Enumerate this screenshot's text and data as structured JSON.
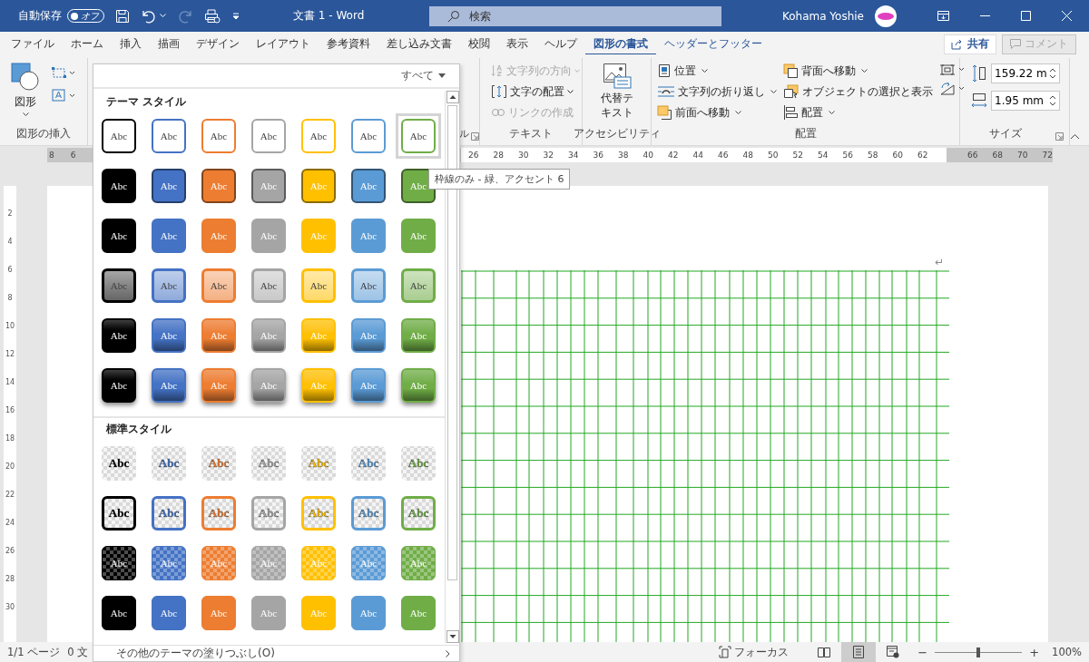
{
  "title_bar": {
    "autosave_label": "自動保存",
    "autosave_toggle": {
      "label": "オフ",
      "on": false
    },
    "title": "文書 1 - Word",
    "search": {
      "placeholder": "検索"
    },
    "user_name": "Kohama Yoshie"
  },
  "ribbon_tabs": [
    {
      "label": "ファイル",
      "selected": false,
      "kind": "normal"
    },
    {
      "label": "ホーム",
      "selected": false,
      "kind": "normal"
    },
    {
      "label": "挿入",
      "selected": false,
      "kind": "normal"
    },
    {
      "label": "描画",
      "selected": false,
      "kind": "normal"
    },
    {
      "label": "デザイン",
      "selected": false,
      "kind": "normal"
    },
    {
      "label": "レイアウト",
      "selected": false,
      "kind": "normal"
    },
    {
      "label": "参考資料",
      "selected": false,
      "kind": "normal"
    },
    {
      "label": "差し込み文書",
      "selected": false,
      "kind": "normal"
    },
    {
      "label": "校閲",
      "selected": false,
      "kind": "normal"
    },
    {
      "label": "表示",
      "selected": false,
      "kind": "normal"
    },
    {
      "label": "ヘルプ",
      "selected": false,
      "kind": "normal"
    },
    {
      "label": "図形の書式",
      "selected": true,
      "kind": "normal"
    },
    {
      "label": "ヘッダーとフッター",
      "selected": false,
      "kind": "contextual"
    }
  ],
  "share_button": "共有",
  "comment_button": {
    "label": "コメント",
    "disabled": true
  },
  "ribbon": {
    "insert_shapes": {
      "shapes_button": "図形",
      "label": "図形の挿入"
    },
    "wordart": {
      "label": "ル"
    },
    "text_group": {
      "label": "テキスト",
      "buttons": [
        {
          "label": "文字列の方向",
          "disabled": true,
          "dropdown": true
        },
        {
          "label": "文字の配置",
          "disabled": false,
          "dropdown": true
        },
        {
          "label": "リンクの作成",
          "disabled": true,
          "dropdown": false
        }
      ]
    },
    "accessibility": {
      "label": "アクセシビリティ",
      "alt_text_button": "代替テキスト"
    },
    "arrange": {
      "label": "配置",
      "column_1": [
        {
          "label": "位置",
          "dropdown": true
        },
        {
          "label": "文字列の折り返し",
          "dropdown": true
        },
        {
          "label": "前面へ移動",
          "dropdown": true
        }
      ],
      "column_2": [
        {
          "label": "背面へ移動",
          "dropdown": true
        },
        {
          "label": "オブジェクトの選択と表示",
          "dropdown": false
        },
        {
          "label": "配置",
          "dropdown": true
        }
      ]
    },
    "size": {
      "label": "サイズ",
      "height": "159.22 m",
      "width": "1.95 mm"
    }
  },
  "ruler": {
    "left_numbers": [
      "8",
      "6"
    ],
    "numbers": [
      "26",
      "28",
      "30",
      "32",
      "34",
      "36",
      "38",
      "40",
      "42",
      "44",
      "46",
      "48",
      "50",
      "52",
      "54",
      "56",
      "58",
      "60",
      "62"
    ],
    "right_numbers": [
      "66",
      "68",
      "70",
      "72"
    ]
  },
  "vertical_ruler": [
    "2",
    "4",
    "6",
    "8",
    "10",
    "12",
    "14",
    "16",
    "18",
    "20",
    "22",
    "24",
    "26",
    "28",
    "30"
  ],
  "document": {
    "paragraph_mark": "↵"
  },
  "gallery": {
    "filter": "すべて",
    "theme_heading": "テーマ スタイル",
    "theme_styles": [
      {
        "kind": "outline",
        "swatches": [
          {
            "label": "Abc",
            "color": "#000000",
            "selected": false
          },
          {
            "label": "Abc",
            "color": "#4472c4",
            "selected": false
          },
          {
            "label": "Abc",
            "color": "#ed7d31",
            "selected": false
          },
          {
            "label": "Abc",
            "color": "#a5a5a5",
            "selected": false
          },
          {
            "label": "Abc",
            "color": "#ffc000",
            "selected": false
          },
          {
            "label": "Abc",
            "color": "#5b9bd5",
            "selected": false
          },
          {
            "label": "Abc",
            "color": "#70ad47",
            "selected": true
          }
        ]
      },
      {
        "kind": "fill_outline",
        "swatches": [
          {
            "label": "Abc",
            "color": "#000000",
            "selected": false
          },
          {
            "label": "Abc",
            "color": "#4472c4",
            "selected": false
          },
          {
            "label": "Abc",
            "color": "#ed7d31",
            "selected": false
          },
          {
            "label": "Abc",
            "color": "#a5a5a5",
            "selected": false
          },
          {
            "label": "Abc",
            "color": "#ffc000",
            "selected": false
          },
          {
            "label": "Abc",
            "color": "#5b9bd5",
            "selected": false
          },
          {
            "label": "Abc",
            "color": "#70ad47",
            "selected": false
          }
        ]
      },
      {
        "kind": "fill",
        "swatches": [
          {
            "label": "Abc",
            "color": "#000000",
            "selected": false
          },
          {
            "label": "Abc",
            "color": "#4472c4",
            "selected": false
          },
          {
            "label": "Abc",
            "color": "#ed7d31",
            "selected": false
          },
          {
            "label": "Abc",
            "color": "#a5a5a5",
            "selected": false
          },
          {
            "label": "Abc",
            "color": "#ffc000",
            "selected": false
          },
          {
            "label": "Abc",
            "color": "#5b9bd5",
            "selected": false
          },
          {
            "label": "Abc",
            "color": "#70ad47",
            "selected": false
          }
        ]
      },
      {
        "kind": "light",
        "swatches": [
          {
            "label": "Abc",
            "color": "#000000",
            "selected": false
          },
          {
            "label": "Abc",
            "color": "#4472c4",
            "selected": false
          },
          {
            "label": "Abc",
            "color": "#ed7d31",
            "selected": false
          },
          {
            "label": "Abc",
            "color": "#a5a5a5",
            "selected": false
          },
          {
            "label": "Abc",
            "color": "#ffc000",
            "selected": false
          },
          {
            "label": "Abc",
            "color": "#5b9bd5",
            "selected": false
          },
          {
            "label": "Abc",
            "color": "#70ad47",
            "selected": false
          }
        ]
      },
      {
        "kind": "gradient",
        "swatches": [
          {
            "label": "Abc",
            "color": "#000000",
            "selected": false
          },
          {
            "label": "Abc",
            "color": "#4472c4",
            "selected": false
          },
          {
            "label": "Abc",
            "color": "#ed7d31",
            "selected": false
          },
          {
            "label": "Abc",
            "color": "#a5a5a5",
            "selected": false
          },
          {
            "label": "Abc",
            "color": "#ffc000",
            "selected": false
          },
          {
            "label": "Abc",
            "color": "#5b9bd5",
            "selected": false
          },
          {
            "label": "Abc",
            "color": "#70ad47",
            "selected": false
          }
        ]
      },
      {
        "kind": "shadow",
        "swatches": [
          {
            "label": "Abc",
            "color": "#000000",
            "selected": false
          },
          {
            "label": "Abc",
            "color": "#4472c4",
            "selected": false
          },
          {
            "label": "Abc",
            "color": "#ed7d31",
            "selected": false
          },
          {
            "label": "Abc",
            "color": "#a5a5a5",
            "selected": false
          },
          {
            "label": "Abc",
            "color": "#ffc000",
            "selected": false
          },
          {
            "label": "Abc",
            "color": "#5b9bd5",
            "selected": false
          },
          {
            "label": "Abc",
            "color": "#70ad47",
            "selected": false
          }
        ]
      }
    ],
    "standard_heading": "標準スタイル",
    "standard_styles": [
      {
        "kind": "checker",
        "swatches": [
          {
            "label": "Abc",
            "color": "#000000",
            "selected": false
          },
          {
            "label": "Abc",
            "color": "#4472c4",
            "selected": false
          },
          {
            "label": "Abc",
            "color": "#ed7d31",
            "selected": false
          },
          {
            "label": "Abc",
            "color": "#a5a5a5",
            "selected": false
          },
          {
            "label": "Abc",
            "color": "#ffc000",
            "selected": false
          },
          {
            "label": "Abc",
            "color": "#5b9bd5",
            "selected": false
          },
          {
            "label": "Abc",
            "color": "#70ad47",
            "selected": false
          }
        ]
      },
      {
        "kind": "checker_outline",
        "swatches": [
          {
            "label": "Abc",
            "color": "#000000",
            "selected": false
          },
          {
            "label": "Abc",
            "color": "#4472c4",
            "selected": false
          },
          {
            "label": "Abc",
            "color": "#ed7d31",
            "selected": false
          },
          {
            "label": "Abc",
            "color": "#a5a5a5",
            "selected": false
          },
          {
            "label": "Abc",
            "color": "#ffc000",
            "selected": false
          },
          {
            "label": "Abc",
            "color": "#5b9bd5",
            "selected": false
          },
          {
            "label": "Abc",
            "color": "#70ad47",
            "selected": false
          }
        ]
      },
      {
        "kind": "checker_fill",
        "swatches": [
          {
            "label": "Abc",
            "color": "#000000",
            "selected": false
          },
          {
            "label": "Abc",
            "color": "#4472c4",
            "selected": false
          },
          {
            "label": "Abc",
            "color": "#ed7d31",
            "selected": false
          },
          {
            "label": "Abc",
            "color": "#a5a5a5",
            "selected": false
          },
          {
            "label": "Abc",
            "color": "#ffc000",
            "selected": false
          },
          {
            "label": "Abc",
            "color": "#5b9bd5",
            "selected": false
          },
          {
            "label": "Abc",
            "color": "#70ad47",
            "selected": false
          }
        ]
      },
      {
        "kind": "solid",
        "swatches": [
          {
            "label": "Abc",
            "color": "#000000",
            "selected": false
          },
          {
            "label": "Abc",
            "color": "#4472c4",
            "selected": false
          },
          {
            "label": "Abc",
            "color": "#ed7d31",
            "selected": false
          },
          {
            "label": "Abc",
            "color": "#a5a5a5",
            "selected": false
          },
          {
            "label": "Abc",
            "color": "#ffc000",
            "selected": false
          },
          {
            "label": "Abc",
            "color": "#5b9bd5",
            "selected": false
          },
          {
            "label": "Abc",
            "color": "#70ad47",
            "selected": false
          }
        ]
      }
    ],
    "more_fills": "その他のテーマの塗りつぶし(O)"
  },
  "tooltip": "枠線のみ - 緑、アクセント 6",
  "status_bar": {
    "page": "1/1 ページ",
    "words": "0 文",
    "focus": "フォーカス",
    "views": [
      {
        "selected": false
      },
      {
        "selected": true
      },
      {
        "selected": false
      }
    ],
    "zoom_out": "−",
    "zoom_in": "+",
    "zoom": {
      "level": 0.5,
      "reading": "100%"
    }
  }
}
